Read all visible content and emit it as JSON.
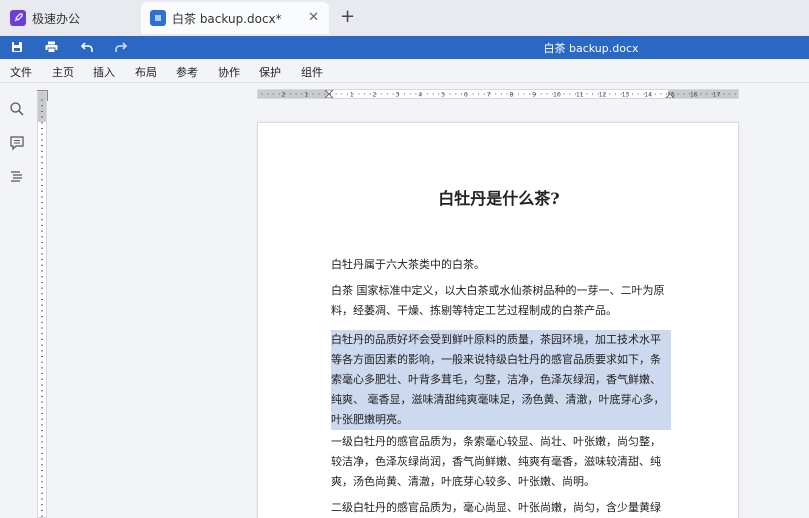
{
  "tabs": [
    {
      "label": "极速办公",
      "icon": "rocket-icon"
    },
    {
      "label": "白茶 backup.docx*",
      "icon": "document-icon"
    }
  ],
  "toolbar": {
    "doc_title": "白茶 backup.docx",
    "icons": [
      "save-icon",
      "print-icon",
      "undo-icon",
      "redo-icon"
    ]
  },
  "menu": [
    "文件",
    "主页",
    "插入",
    "布局",
    "参考",
    "协作",
    "保护",
    "组件"
  ],
  "rail_icons": [
    "search-icon",
    "comment-icon",
    "navigation-icon"
  ],
  "ruler": {
    "corner_glyph": "L",
    "labels": [
      "2",
      "1",
      "1",
      "2",
      "3",
      "4",
      "5",
      "6",
      "7",
      "8",
      "9",
      "10",
      "11",
      "12",
      "13",
      "14",
      "15",
      "16",
      "17"
    ]
  },
  "document": {
    "heading": "白牡丹是什么茶?",
    "paragraphs": [
      "白牡丹属于六大茶类中的白茶。",
      "白茶  国家标准中定义，以大白茶或水仙茶树品种的一芽一、二叶为原料，经萎凋、干燥、拣剔等特定工艺过程制成的白茶产品。",
      "白牡丹的品质好坏会受到鲜叶原料的质量，茶园环境，加工技术水平等各方面因素的影响，一般来说特级白牡丹的感官品质要求如下，条索毫心多肥壮、叶背多茸毛，匀整，洁净，色泽灰绿润，香气鲜嫩、纯爽、 毫香显，滋味清甜纯爽毫味足，汤色黄、清澈，叶底芽心多，叶张肥嫩明亮。",
      "一级白牡丹的感官品质为，条索毫心较显、尚壮、叶张嫩，尚匀整，较洁净，色泽灰绿尚润，香气尚鲜嫩、纯爽有毫香，滋味较清甜、纯爽，汤色尚黄、清澈，叶底芽心较多、叶张嫩、尚明。",
      "二级白牡丹的感官品质为，毫心尚显、叶张尚嫩，尚匀，含少量黄绿片，"
    ]
  },
  "colors": {
    "accent": "#2b68c3",
    "selection": "#cdd9ee"
  }
}
